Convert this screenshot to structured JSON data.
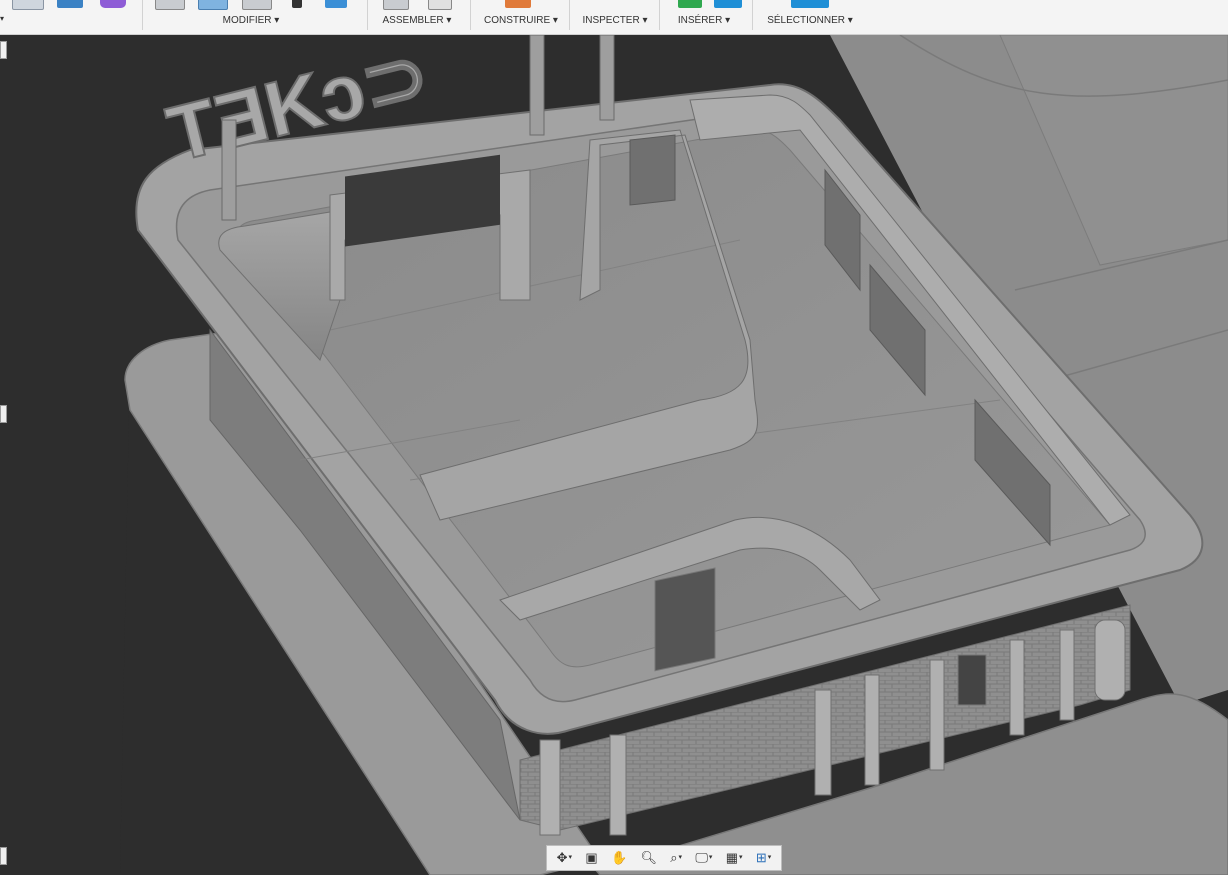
{
  "toolbar": {
    "groups": [
      {
        "label": "MODIFIER"
      },
      {
        "label": "ASSEMBLER"
      },
      {
        "label": "CONSTRUIRE"
      },
      {
        "label": "INSPECTER"
      },
      {
        "label": "INSÉRER"
      },
      {
        "label": "SÉLECTIONNER"
      }
    ]
  },
  "scene": {
    "sign_text": "ΤƎKɔ⊃",
    "colors": {
      "background": "#2d2d2d",
      "model": "#8e8e8e",
      "accent_blue": "#1f8fd6"
    }
  },
  "navbar": {
    "tools": [
      {
        "icon": "orbit-icon"
      },
      {
        "icon": "look-at-icon"
      },
      {
        "icon": "pan-hand-icon"
      },
      {
        "icon": "zoom-icon"
      },
      {
        "icon": "zoom-window-icon"
      },
      {
        "icon": "display-settings-icon"
      },
      {
        "icon": "grid-settings-icon"
      },
      {
        "icon": "viewports-icon"
      }
    ]
  }
}
